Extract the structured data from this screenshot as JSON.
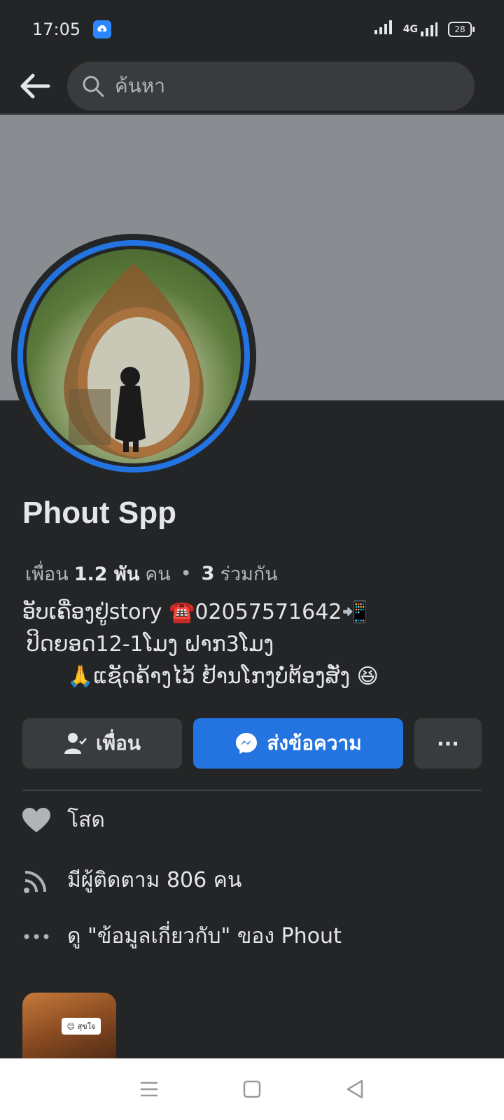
{
  "status_bar": {
    "time": "17:05",
    "network": "4G",
    "battery": "28",
    "app_icon": "cloud-upload-icon"
  },
  "search": {
    "placeholder": "ค้นหา"
  },
  "profile": {
    "name": "Phout Spp",
    "friends_label": "เพื่อน",
    "friends_count": "1.2 พัน",
    "friends_unit": "คน",
    "separator": "•",
    "mutual_count": "3",
    "mutual_label": "ร่วมกัน",
    "bio": [
      "ອັບເຄື່ອງຢູ່story ☎️02057571642📲",
      "ປິດຍອດ12-1ໂມງ ຝາກ3ໂມງ",
      "🙏ແຊັດຄ້າງໄວ້ ຢ້ານໂກງບໍ່ຕ້ອງສັ່ງ 😆"
    ]
  },
  "actions": {
    "friend_label": "เพื่อน",
    "message_label": "ส่งข้อความ",
    "more_label": "···"
  },
  "info": {
    "relationship": "โสด",
    "followers": "มีผู้ติดตาม 806 คน",
    "about": "ดู \"ข้อมูลเกี่ยวกับ\" ของ Phout"
  },
  "story": {
    "tag_text": "😊 สุขใจ"
  },
  "colors": {
    "background": "#242526",
    "accent": "#2374e1",
    "cover": "#898d92"
  }
}
